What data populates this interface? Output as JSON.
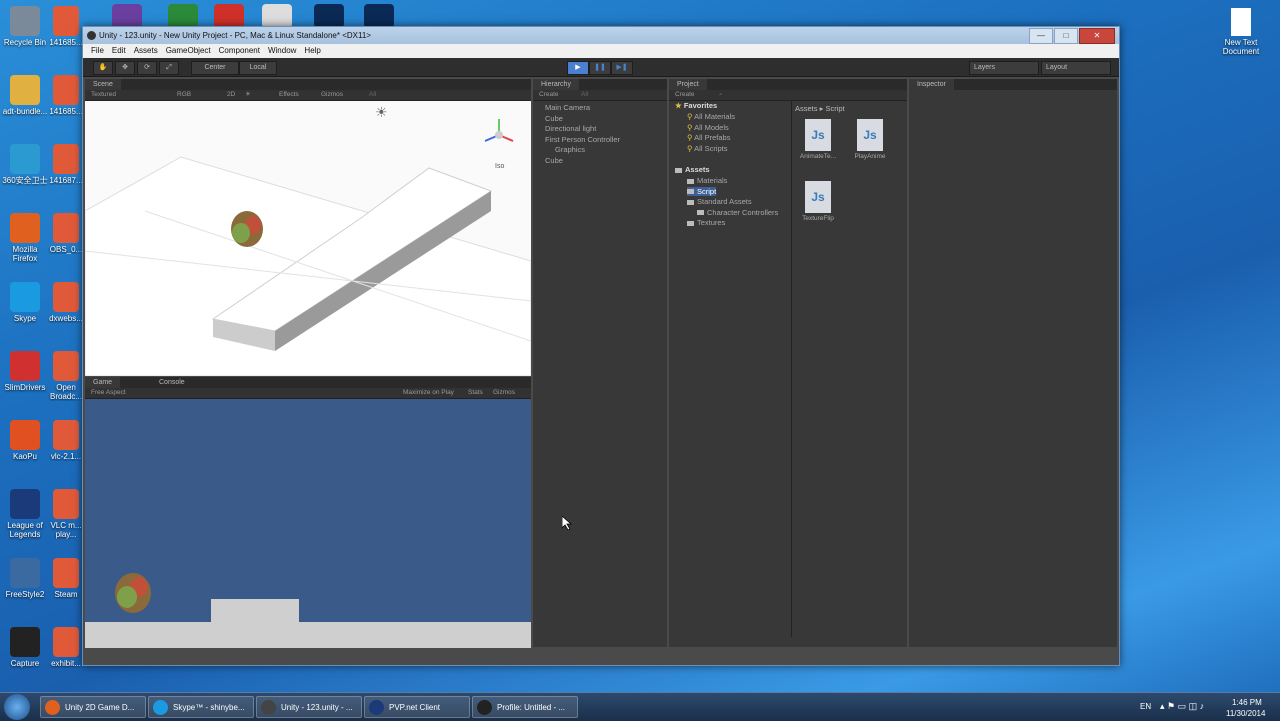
{
  "desktop": {
    "left_icons": [
      {
        "label": "Recycle Bin",
        "icon": "recycle-bin-icon"
      },
      {
        "label": "adt-bundle...",
        "icon": "folder-icon"
      },
      {
        "label": "360安全卫士",
        "icon": "security-icon"
      },
      {
        "label": "Mozilla Firefox",
        "icon": "firefox-icon"
      },
      {
        "label": "Skype",
        "icon": "skype-icon"
      },
      {
        "label": "SlimDrivers",
        "icon": "slimdrivers-icon"
      },
      {
        "label": "KaoPu",
        "icon": "kaopu-icon"
      },
      {
        "label": "League of Legends",
        "icon": "lol-icon"
      },
      {
        "label": "FreeStyle2",
        "icon": "freestyle-icon"
      },
      {
        "label": "Capture",
        "icon": "capture-icon"
      }
    ],
    "col2_icons": [
      "141685...",
      "141685...",
      "141687...",
      "OBS_0...",
      "dxwebs...",
      "Open Broadc...",
      "vlc-2.1...",
      "VLC m... play...",
      "Steam",
      "exhibit..."
    ],
    "right_icon": {
      "label": "New Text Document",
      "icon": "text-document-icon"
    }
  },
  "window": {
    "title": "Unity - 123.unity - New Unity Project - PC, Mac & Linux Standalone* <DX11>",
    "buttons": {
      "minimize": "—",
      "maximize": "□",
      "close": "✕"
    }
  },
  "menu": [
    "File",
    "Edit",
    "Assets",
    "GameObject",
    "Component",
    "Window",
    "Help"
  ],
  "toolbar": {
    "pivot": "Center",
    "space": "Local",
    "layers": "Layers",
    "layout": "Layout"
  },
  "scene": {
    "tab": "Scene",
    "shading": "Textured",
    "render": "RGB",
    "mode2d": "2D",
    "effects": "Effects",
    "gizmos": "Gizmos",
    "search": "All",
    "view_label": "Iso"
  },
  "game": {
    "tab": "Game",
    "console_tab": "Console",
    "aspect": "Free Aspect",
    "maximize": "Maximize on Play",
    "stats": "Stats",
    "gizmos": "Gizmos"
  },
  "hierarchy": {
    "tab": "Hierarchy",
    "create": "Create",
    "search": "All",
    "items": [
      {
        "label": "Main Camera",
        "indent": 0
      },
      {
        "label": "Cube",
        "indent": 0
      },
      {
        "label": "Directional light",
        "indent": 0
      },
      {
        "label": "First Person Controller",
        "indent": 0
      },
      {
        "label": "Graphics",
        "indent": 1
      },
      {
        "label": "Cube",
        "indent": 0
      }
    ]
  },
  "project": {
    "tab": "Project",
    "create": "Create",
    "favorites_label": "Favorites",
    "favorites": [
      "All Materials",
      "All Models",
      "All Prefabs",
      "All Scripts"
    ],
    "assets_label": "Assets",
    "assets_tree": [
      {
        "label": "Materials",
        "indent": 1
      },
      {
        "label": "Script",
        "indent": 1
      },
      {
        "label": "Standard Assets",
        "indent": 1
      },
      {
        "label": "Character Controllers",
        "indent": 2
      },
      {
        "label": "Textures",
        "indent": 1
      }
    ],
    "breadcrumb": "Assets ▸ Script",
    "files": [
      "AnimateTe...",
      "PlayAnime",
      "TextureFlip"
    ]
  },
  "inspector": {
    "tab": "Inspector"
  },
  "taskbar": {
    "tasks": [
      "Unity 2D Game D...",
      "Skype™ - shinybe...",
      "Unity - 123.unity - ...",
      "PVP.net Client",
      "Profile: Untitled - ..."
    ],
    "lang": "EN",
    "time": "1:46 PM",
    "date": "11/30/2014"
  },
  "colors": {
    "accent_play": "#4a7fd1",
    "game_bg": "#3a5a8a"
  }
}
